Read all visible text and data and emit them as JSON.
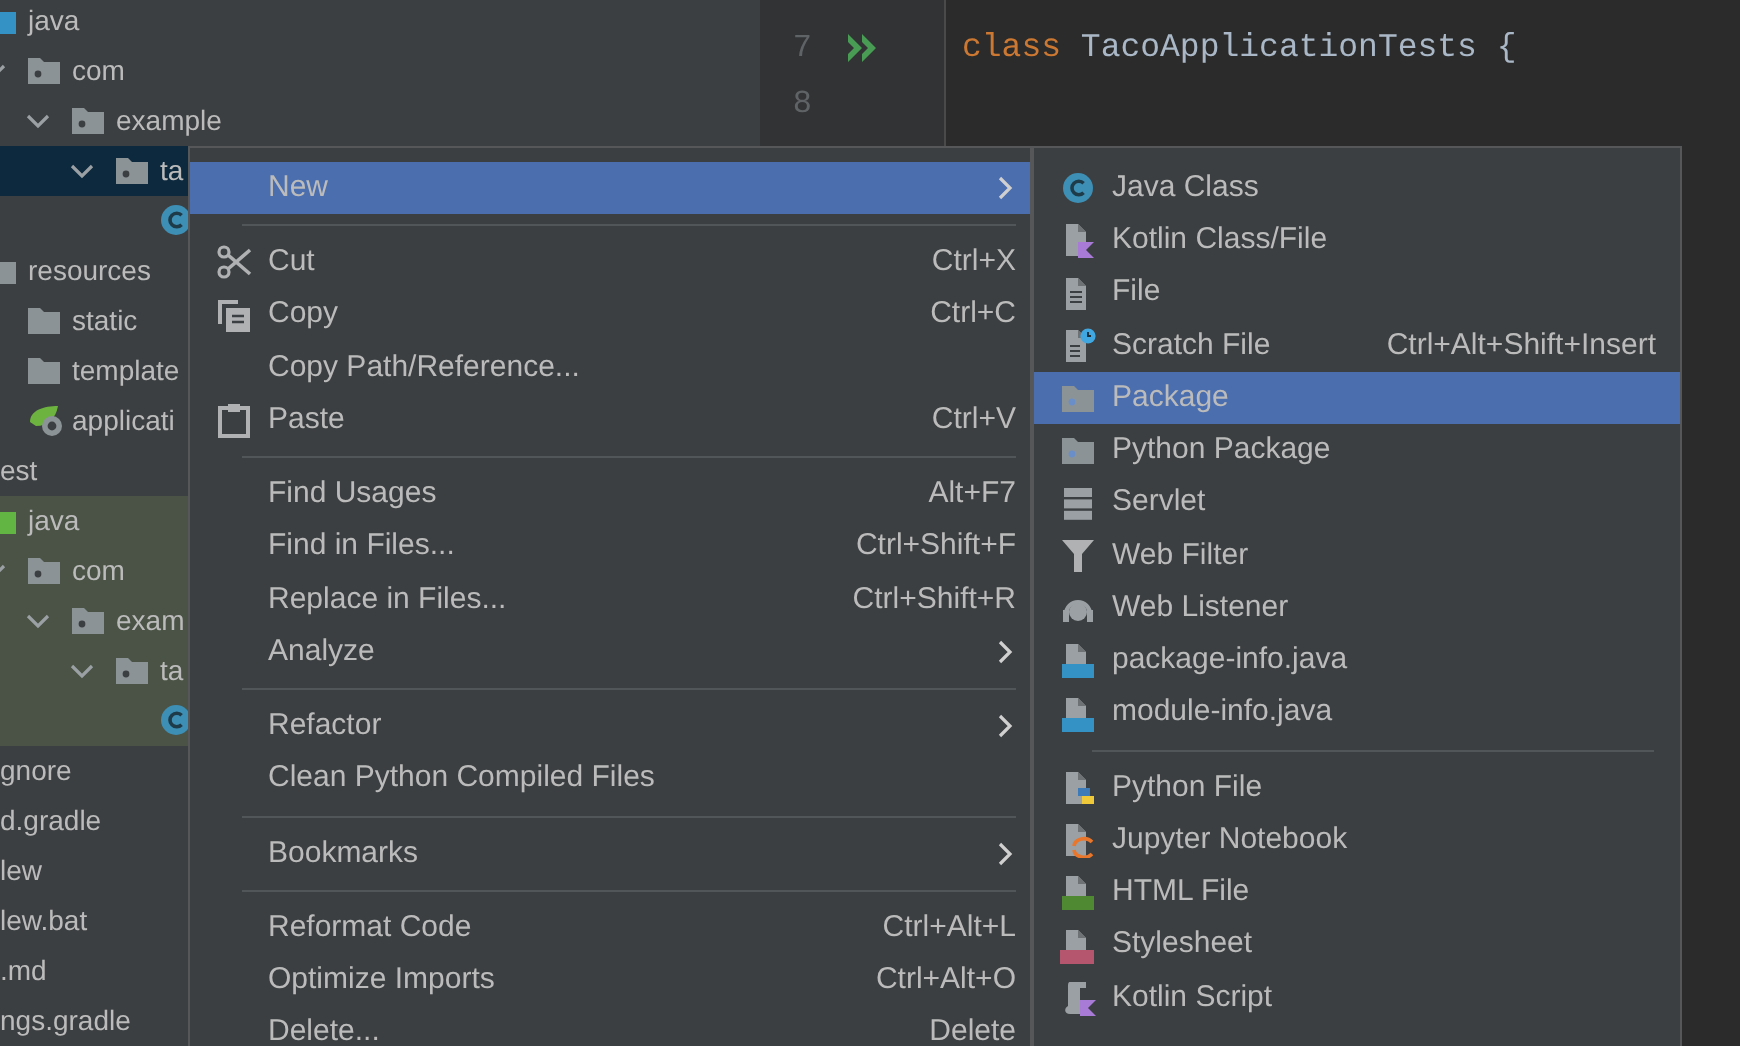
{
  "project_tree": {
    "upper_children": [
      {
        "label": "java",
        "kind": "source-root",
        "selected": false,
        "children": [
          {
            "label": "com",
            "kind": "package",
            "selected": false,
            "expanded": true,
            "children": [
              {
                "label": "example",
                "kind": "package",
                "selected": false,
                "expanded": true,
                "children": [
                  {
                    "label": "ta",
                    "kind": "package",
                    "selected": true,
                    "expanded": true,
                    "children": [
                      {
                        "kind": "java-class",
                        "selected": false
                      }
                    ]
                  }
                ]
              }
            ]
          }
        ]
      },
      {
        "label": "resources",
        "kind": "resources-root",
        "selected": false,
        "children": [
          {
            "label": "static",
            "kind": "folder",
            "selected": false
          },
          {
            "label": "template",
            "kind": "folder",
            "selected": false
          },
          {
            "label": "applicati",
            "kind": "spring-config",
            "selected": false
          }
        ]
      }
    ],
    "items": [
      {
        "label": "est",
        "selected": false,
        "children": [
          {
            "label": "java",
            "kind": "test-root",
            "selected": false,
            "scope_highlight": true,
            "children": [
              {
                "label": "com",
                "kind": "package",
                "selected": false,
                "expanded": true,
                "children": [
                  {
                    "label": "exam",
                    "kind": "package",
                    "selected": false,
                    "expanded": true,
                    "children": [
                      {
                        "label": "ta",
                        "kind": "package",
                        "selected": false,
                        "expanded": true,
                        "children": [
                          {
                            "kind": "java-class",
                            "selected": false
                          }
                        ]
                      }
                    ]
                  }
                ]
              }
            ]
          }
        ]
      },
      {
        "label": "gnore",
        "selected": false
      },
      {
        "label": "d.gradle",
        "selected": false
      },
      {
        "label": "lew",
        "selected": false
      },
      {
        "label": "lew.bat",
        "selected": false
      },
      {
        "label": ".md",
        "selected": false
      },
      {
        "label": "ngs.gradle",
        "selected": false
      }
    ]
  },
  "editor": {
    "lines": [
      {
        "number": "7",
        "run_marker": true,
        "keyword": "class",
        "code": "TacoApplicationTests {"
      },
      {
        "number": "8",
        "run_marker": false
      }
    ]
  },
  "context_menu": [
    [
      {
        "label": "New",
        "selected": true,
        "submenu": true
      }
    ],
    [
      {
        "kind": "cut",
        "label": "Cut",
        "shortcut": "Ctrl+X",
        "selected": false,
        "submenu": false
      },
      {
        "kind": "copy",
        "label": "Copy",
        "shortcut": "Ctrl+C",
        "selected": false,
        "submenu": false
      },
      {
        "label": "Copy Path/Reference...",
        "selected": false,
        "submenu": false
      },
      {
        "kind": "paste",
        "label": "Paste",
        "shortcut": "Ctrl+V",
        "selected": false,
        "submenu": false
      }
    ],
    [
      {
        "label": "Find Usages",
        "shortcut": "Alt+F7",
        "selected": false,
        "submenu": false
      },
      {
        "label": "Find in Files...",
        "shortcut": "Ctrl+Shift+F",
        "selected": false,
        "submenu": false
      },
      {
        "label": "Replace in Files...",
        "shortcut": "Ctrl+Shift+R",
        "selected": false,
        "submenu": false
      },
      {
        "label": "Analyze",
        "selected": false,
        "submenu": true
      }
    ],
    [
      {
        "label": "Refactor",
        "selected": false,
        "submenu": true
      },
      {
        "label": "Clean Python Compiled Files",
        "selected": false,
        "submenu": false
      }
    ],
    [
      {
        "label": "Bookmarks",
        "selected": false,
        "submenu": true
      }
    ],
    [
      {
        "label": "Reformat Code",
        "shortcut": "Ctrl+Alt+L",
        "selected": false,
        "submenu": false
      },
      {
        "label": "Optimize Imports",
        "shortcut": "Ctrl+Alt+O",
        "selected": false,
        "submenu": false
      },
      {
        "label": "Delete...",
        "shortcut": "Delete",
        "selected": false,
        "submenu": false
      }
    ]
  ],
  "new_submenu": [
    [
      {
        "kind": "java-class",
        "label": "Java Class",
        "selected": false
      },
      {
        "kind": "kotlin-file",
        "label": "Kotlin Class/File",
        "selected": false
      },
      {
        "kind": "file",
        "label": "File",
        "selected": false
      },
      {
        "kind": "scratch-file",
        "label": "Scratch File",
        "shortcut": "Ctrl+Alt+Shift+Insert",
        "selected": false
      },
      {
        "kind": "package",
        "label": "Package",
        "selected": true
      },
      {
        "kind": "package",
        "label": "Python Package",
        "selected": false
      },
      {
        "kind": "servlet",
        "label": "Servlet",
        "selected": false
      },
      {
        "kind": "filter",
        "label": "Web Filter",
        "selected": false
      },
      {
        "kind": "listener",
        "label": "Web Listener",
        "selected": false
      },
      {
        "kind": "java-file",
        "label": "package-info.java",
        "selected": false
      },
      {
        "kind": "java-file",
        "label": "module-info.java",
        "selected": false
      }
    ],
    [
      {
        "kind": "python-file",
        "label": "Python File",
        "selected": false
      },
      {
        "kind": "jupyter-file",
        "label": "Jupyter Notebook",
        "selected": false
      },
      {
        "kind": "html-file",
        "label": "HTML File",
        "selected": false
      },
      {
        "kind": "css-file",
        "label": "Stylesheet",
        "selected": false
      },
      {
        "kind": "kotlin-script",
        "label": "Kotlin Script",
        "selected": false
      }
    ]
  ]
}
